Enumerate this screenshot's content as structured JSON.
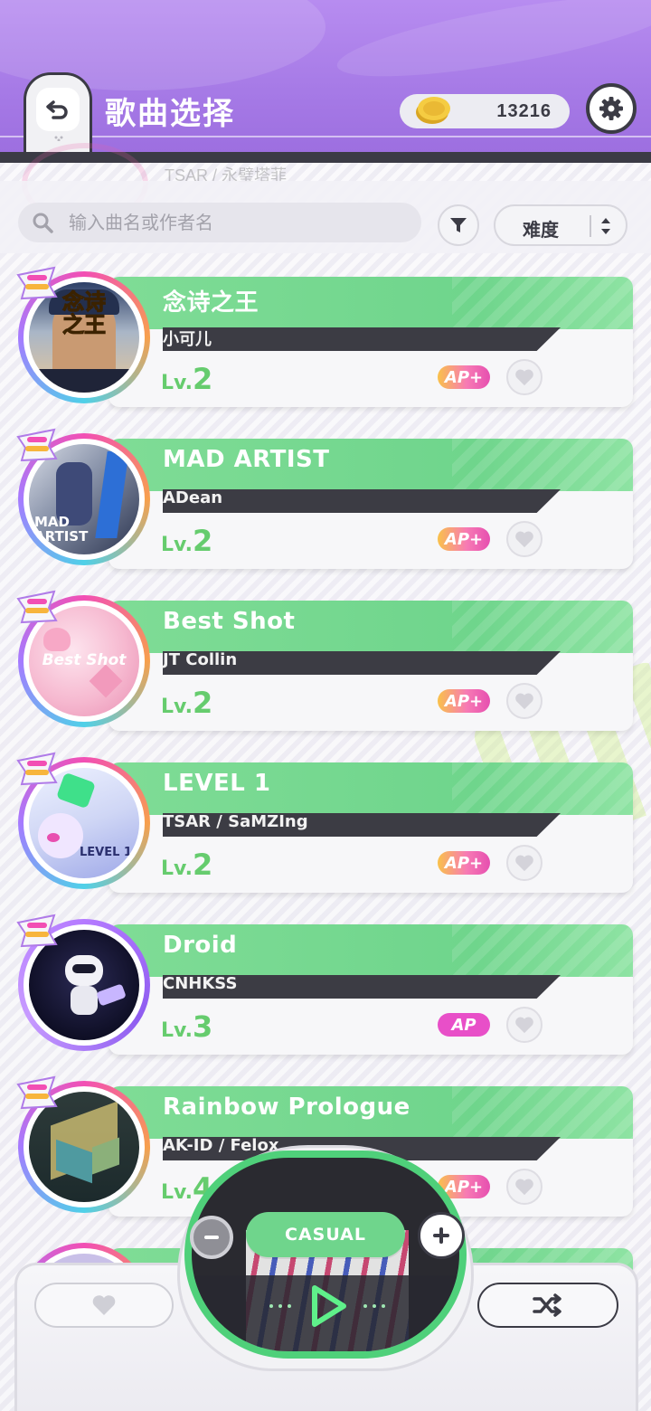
{
  "header": {
    "title": "歌曲选择",
    "coins": "13216",
    "icons": {
      "back": "back-arrow-icon",
      "coin": "coin-icon",
      "settings": "gear-icon"
    }
  },
  "ghost_row": {
    "text": "TSAR / 永璧塔菲"
  },
  "search": {
    "placeholder": "输入曲名或作者名",
    "value": ""
  },
  "sort": {
    "selected": "难度"
  },
  "songs": [
    {
      "title": "念诗之王",
      "artist": "小可儿",
      "lv_prefix": "Lv.",
      "level": "2",
      "ap": "AP+",
      "jacket_text": "念诗之王",
      "ring": "rainbow"
    },
    {
      "title": "MAD ARTIST",
      "artist": "ADean",
      "lv_prefix": "Lv.",
      "level": "2",
      "ap": "AP+",
      "jacket_text": "MAD ARTIST",
      "ring": "rainbow"
    },
    {
      "title": "Best Shot",
      "artist": "JT Collin",
      "lv_prefix": "Lv.",
      "level": "2",
      "ap": "AP+",
      "jacket_text": "Best Shot",
      "ring": "rainbow"
    },
    {
      "title": "LEVEL 1",
      "artist": "TSAR / SaMZIng",
      "lv_prefix": "Lv.",
      "level": "2",
      "ap": "AP+",
      "jacket_text": "LEVEL 1",
      "ring": "rainbow"
    },
    {
      "title": "Droid",
      "artist": "CNHKSS",
      "lv_prefix": "Lv.",
      "level": "3",
      "ap": "AP",
      "jacket_text": "",
      "ring": "purple"
    },
    {
      "title": "Rainbow Prologue",
      "artist": "AK-ID / Felox",
      "lv_prefix": "Lv.",
      "level": "4",
      "ap": "AP+",
      "jacket_text": "",
      "ring": "rainbow"
    }
  ],
  "player": {
    "difficulty": "CASUAL",
    "icons": {
      "minus": "minus-icon",
      "plus": "plus-icon",
      "play": "play-icon",
      "favorite": "heart-icon",
      "shuffle": "shuffle-icon"
    }
  },
  "colors": {
    "header_purple": "#a67ae6",
    "card_green": "#6fd58c",
    "level_green": "#66cc6e",
    "ap_pink": "#e84fc8",
    "dark": "#3b3b45"
  }
}
